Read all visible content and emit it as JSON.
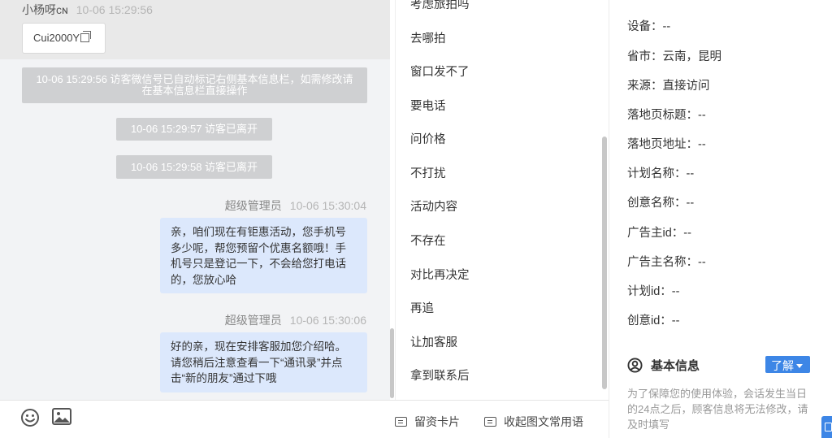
{
  "chat": {
    "visitor": {
      "name": "小杨呀ᴄɴ",
      "time": "10-06 15:29:56",
      "chip": "Cui2000Y"
    },
    "system_messages": [
      "10-06 15:29:56 访客微信号已自动标记右侧基本信息栏，如需修改请在基本信息栏直接操作",
      "10-06 15:29:57 访客已离开",
      "10-06 15:29:58 访客已离开"
    ],
    "messages": [
      {
        "sender": "超级管理员",
        "time": "10-06 15:30:04",
        "text": "亲，咱们现在有钜惠活动，您手机号多少呢，帮您预留个优惠名额哦！手机号只是登记一下，不会给您打电话的，您放心哈"
      },
      {
        "sender": "超级管理员",
        "time": "10-06 15:30:06",
        "text": "好的亲，现在安排客服加您介绍哈。请您稍后注意查看一下“通讯录”并点击“新的朋友”通过下哦"
      }
    ]
  },
  "toolbar": {
    "emoji_icon": "smile-icon",
    "image_icon": "image-icon",
    "card_label": "留资卡片",
    "quick_label": "收起图文常用语"
  },
  "quick_replies": [
    "考虑旅拍吗",
    "去哪拍",
    "窗口发不了",
    "要电话",
    "问价格",
    "不打扰",
    "活动内容",
    "不存在",
    "对比再决定",
    "再追",
    "让加客服",
    "拿到联系后"
  ],
  "info": {
    "fields": [
      {
        "label": "设备：",
        "value": "--"
      },
      {
        "label": "省市：",
        "value": "云南，昆明"
      },
      {
        "label": "来源：",
        "value": "直接访问"
      },
      {
        "label": "落地页标题：",
        "value": "--"
      },
      {
        "label": "落地页地址：",
        "value": "--"
      },
      {
        "label": "计划名称：",
        "value": "--"
      },
      {
        "label": "创意名称：",
        "value": "--"
      },
      {
        "label": "广告主id：",
        "value": "--"
      },
      {
        "label": "广告主名称：",
        "value": "--"
      },
      {
        "label": "计划id：",
        "value": "--"
      },
      {
        "label": "创意id：",
        "value": "--"
      }
    ],
    "basic_title": "基本信息",
    "learn_label": "了解",
    "notice": "为了保障您的使用体验，会话发生当日的24点之后，顾客信息将无法修改，请及时填写"
  },
  "colors": {
    "accent": "#3d86e6",
    "bubble": "#dce8fc",
    "system": "#cfd0d2"
  }
}
